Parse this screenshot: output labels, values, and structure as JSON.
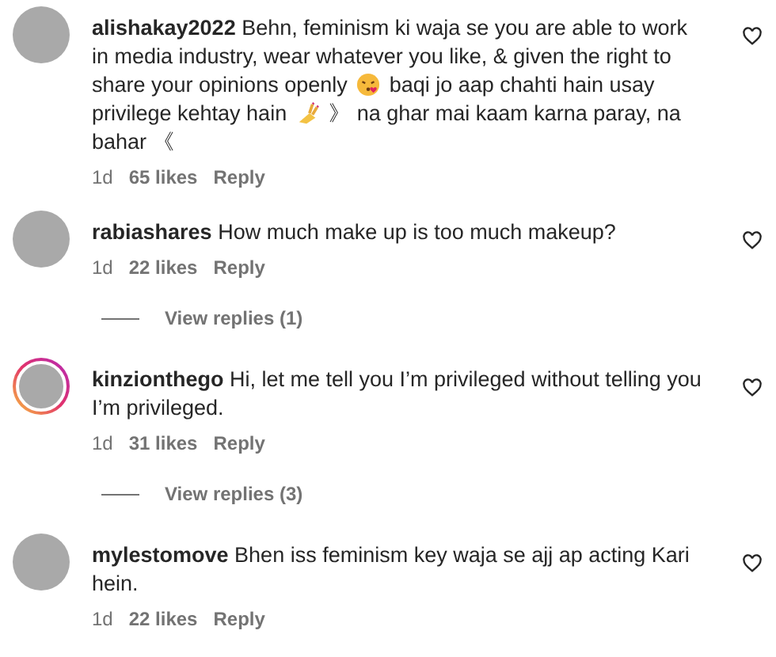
{
  "comments": [
    {
      "username": "alishakay2022",
      "story_ring": false,
      "body": [
        {
          "kind": "text",
          "text": "Behn, feminism ki waja se you are able to work in media industry, wear whatever you like, & given the right to share your opinions openly"
        },
        {
          "kind": "emoji-kiss"
        },
        {
          "kind": "text",
          "text": "baqi jo aap chahti hain usay privilege kehtay hain"
        },
        {
          "kind": "emoji-nails"
        },
        {
          "kind": "text",
          "text": "》 na ghar mai kaam karna paray, na bahar 《"
        }
      ],
      "time": "1d",
      "likes": "65 likes",
      "reply": "Reply"
    },
    {
      "username": "rabiashares",
      "story_ring": false,
      "body": [
        {
          "kind": "text",
          "text": "How much make up is too much makeup?"
        }
      ],
      "time": "1d",
      "likes": "22 likes",
      "reply": "Reply",
      "view_replies": "View replies (1)"
    },
    {
      "username": "kinzionthego",
      "story_ring": true,
      "body": [
        {
          "kind": "text",
          "text": "Hi, let me tell you I’m privileged without telling you I’m privileged."
        }
      ],
      "time": "1d",
      "likes": "31 likes",
      "reply": "Reply",
      "view_replies": "View replies (3)"
    },
    {
      "username": "mylestomove",
      "story_ring": false,
      "body": [
        {
          "kind": "text",
          "text": "Bhen iss feminism key waja se ajj ap acting Kari hein."
        }
      ],
      "time": "1d",
      "likes": "22 likes",
      "reply": "Reply"
    }
  ]
}
